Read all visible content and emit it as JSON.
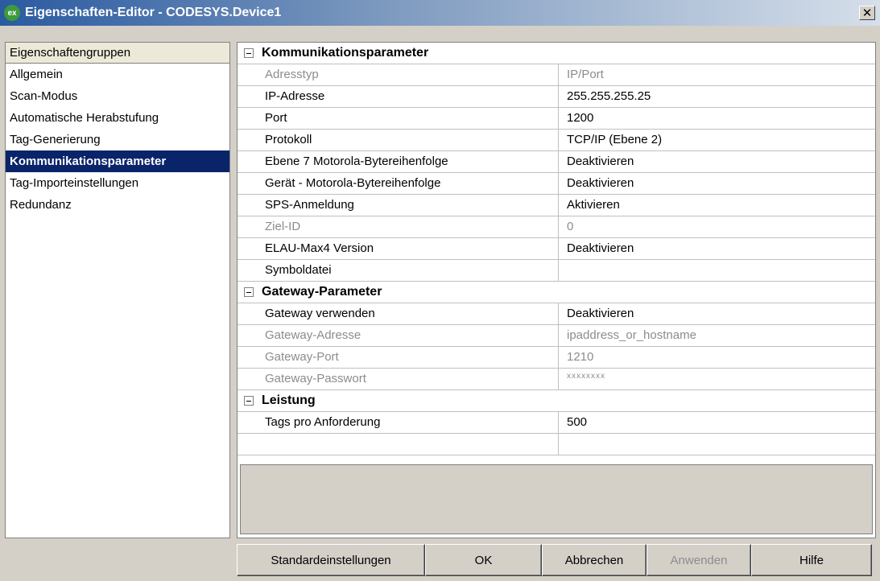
{
  "window": {
    "title": "Eigenschaften-Editor - CODESYS.Device1",
    "icon_text": "ex",
    "close_label": "✕"
  },
  "sidebar": {
    "header": "Eigenschaftengruppen",
    "items": [
      {
        "label": "Allgemein",
        "selected": false
      },
      {
        "label": "Scan-Modus",
        "selected": false
      },
      {
        "label": "Automatische Herabstufung",
        "selected": false
      },
      {
        "label": "Tag-Generierung",
        "selected": false
      },
      {
        "label": "Kommunikationsparameter",
        "selected": true
      },
      {
        "label": "Tag-Importeinstellungen",
        "selected": false
      },
      {
        "label": "Redundanz",
        "selected": false
      }
    ]
  },
  "properties": {
    "categories": [
      {
        "label": "Kommunikationsparameter",
        "rows": [
          {
            "name": "Adresstyp",
            "value": "IP/Port",
            "disabled": true
          },
          {
            "name": "IP-Adresse",
            "value": "255.255.255.25",
            "disabled": false
          },
          {
            "name": "Port",
            "value": "1200",
            "disabled": false
          },
          {
            "name": "Protokoll",
            "value": "TCP/IP (Ebene 2)",
            "disabled": false
          },
          {
            "name": "Ebene 7 Motorola-Bytereihenfolge",
            "value": "Deaktivieren",
            "disabled": false
          },
          {
            "name": "Gerät - Motorola-Bytereihenfolge",
            "value": "Deaktivieren",
            "disabled": false
          },
          {
            "name": "SPS-Anmeldung",
            "value": "Aktivieren",
            "disabled": false
          },
          {
            "name": "Ziel-ID",
            "value": "0",
            "disabled": true
          },
          {
            "name": "ELAU-Max4 Version",
            "value": "Deaktivieren",
            "disabled": false
          },
          {
            "name": "Symboldatei",
            "value": "",
            "disabled": false
          }
        ]
      },
      {
        "label": "Gateway-Parameter",
        "rows": [
          {
            "name": "Gateway verwenden",
            "value": "Deaktivieren",
            "disabled": false
          },
          {
            "name": "Gateway-Adresse",
            "value": "ipaddress_or_hostname",
            "disabled": true
          },
          {
            "name": "Gateway-Port",
            "value": "1210",
            "disabled": true
          },
          {
            "name": "Gateway-Passwort",
            "value": "xxxxxxxx",
            "disabled": true,
            "masked": true
          }
        ]
      },
      {
        "label": "Leistung",
        "rows": [
          {
            "name": "Tags pro Anforderung",
            "value": "500",
            "disabled": false
          }
        ]
      }
    ]
  },
  "buttons": {
    "defaults": "Standardeinstellungen",
    "ok": "OK",
    "cancel": "Abbrechen",
    "apply": "Anwenden",
    "help": "Hilfe"
  }
}
